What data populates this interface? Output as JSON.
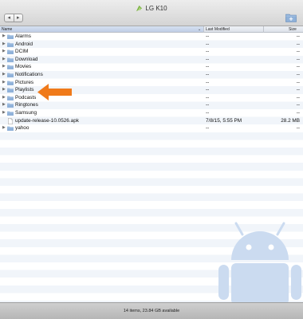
{
  "window": {
    "title": "LG K10",
    "nav": {
      "back": "◂",
      "forward": "▸"
    }
  },
  "columns": {
    "name": "Name",
    "modified": "Last Modified",
    "size": "Size"
  },
  "rows": [
    {
      "type": "folder",
      "name": "Alarms",
      "modified": "--",
      "size": "--"
    },
    {
      "type": "folder",
      "name": "Android",
      "modified": "--",
      "size": "--"
    },
    {
      "type": "folder",
      "name": "DCIM",
      "modified": "--",
      "size": "--"
    },
    {
      "type": "folder",
      "name": "Download",
      "modified": "--",
      "size": "--"
    },
    {
      "type": "folder",
      "name": "Movies",
      "modified": "--",
      "size": "--"
    },
    {
      "type": "folder",
      "name": "Notifications",
      "modified": "--",
      "size": "--"
    },
    {
      "type": "folder",
      "name": "Pictures",
      "modified": "--",
      "size": "--"
    },
    {
      "type": "folder",
      "name": "Playlists",
      "modified": "--",
      "size": "--"
    },
    {
      "type": "folder",
      "name": "Podcasts",
      "modified": "--",
      "size": "--"
    },
    {
      "type": "folder",
      "name": "Ringtones",
      "modified": "--",
      "size": "--"
    },
    {
      "type": "folder",
      "name": "Samsung",
      "modified": "--",
      "size": "--"
    },
    {
      "type": "file",
      "name": "update-release-10.0526.apk",
      "modified": "7/8/15, 5:55 PM",
      "size": "28.2 MB"
    },
    {
      "type": "folder",
      "name": "yahoo",
      "modified": "--",
      "size": "--"
    }
  ],
  "status": {
    "text": "14 items, 23.84 GB available"
  },
  "colors": {
    "highlight_arrow": "#f07a1a",
    "folder": "#8fb1d9",
    "android_watermark": "#c9daf0"
  },
  "icons": {
    "app": "android-file-transfer-icon",
    "new_folder": "new-folder-icon",
    "folder": "folder-icon",
    "file": "file-icon",
    "disclosure": "disclosure-triangle-icon",
    "pointer": "orange-arrow-pointer",
    "watermark": "android-robot-icon"
  }
}
